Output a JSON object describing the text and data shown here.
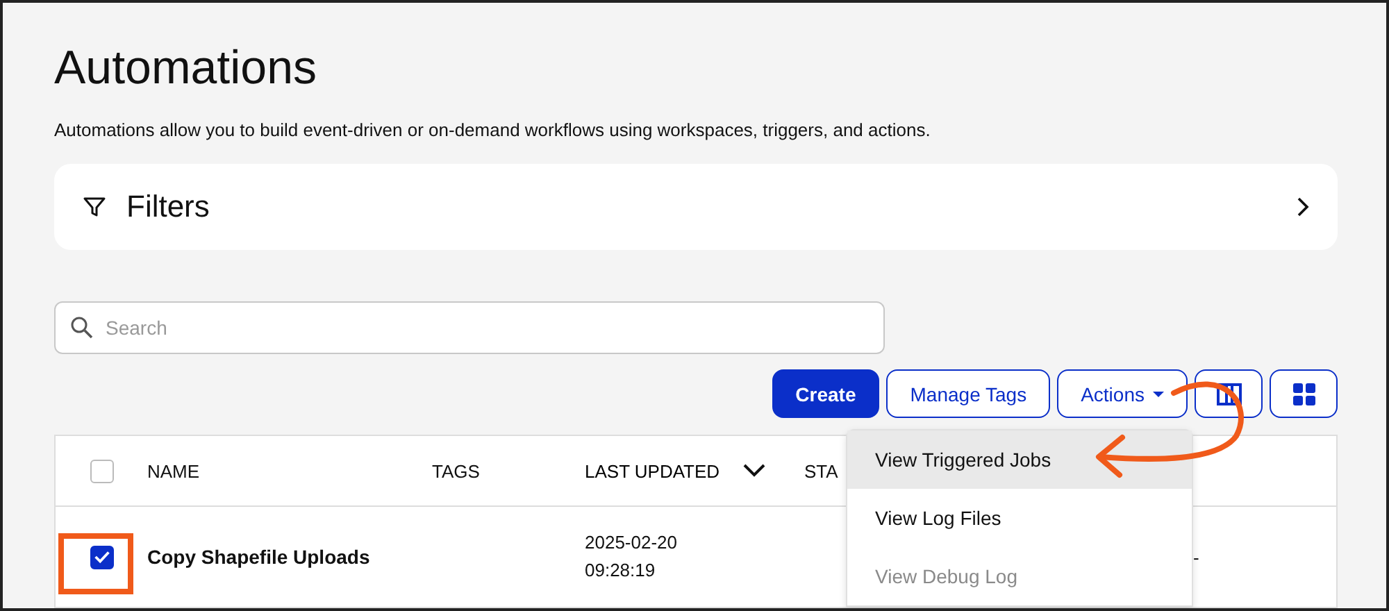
{
  "page": {
    "title": "Automations",
    "description": "Automations allow you to build event-driven or on-demand workflows using workspaces, triggers, and actions."
  },
  "filters": {
    "label": "Filters",
    "expanded": false
  },
  "search": {
    "placeholder": "Search"
  },
  "toolbar": [
    {
      "kind": "primary",
      "label": "Create"
    },
    {
      "kind": "outline",
      "label": "Manage Tags"
    },
    {
      "kind": "menu",
      "label": "Actions"
    },
    {
      "kind": "columns"
    },
    {
      "kind": "grid"
    }
  ],
  "actions_menu": [
    {
      "label": "View Triggered Jobs",
      "selected": true,
      "disabled": false
    },
    {
      "label": "View Log Files",
      "selected": false,
      "disabled": false
    },
    {
      "label": "View Debug Log",
      "selected": false,
      "disabled": true
    }
  ],
  "table": {
    "select_all_checked": false,
    "columns": [
      {
        "label": "NAME",
        "sorted": false
      },
      {
        "label": "TAGS",
        "sorted": false
      },
      {
        "label": "LAST UPDATED",
        "sorted": true
      },
      {
        "label": "STA",
        "sorted": false
      }
    ],
    "rows": [
      {
        "checked": true,
        "name": "Copy Shapefile Uploads",
        "last_updated": "2025-02-20 09:28:19",
        "column_6": "-"
      }
    ]
  }
}
